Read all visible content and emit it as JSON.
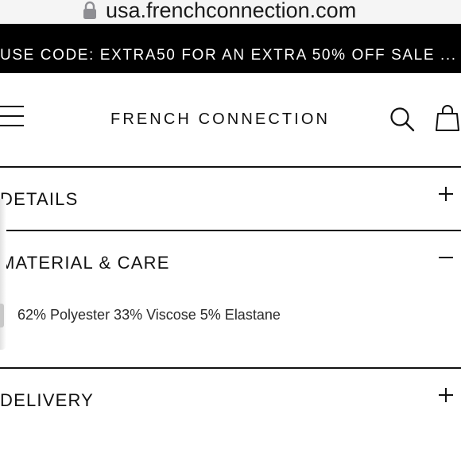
{
  "browser": {
    "url": "usa.frenchconnection.com",
    "lock_icon": "lock-icon"
  },
  "promo": {
    "text": "USE CODE: EXTRA50 FOR AN EXTRA 50% OFF SALE ..."
  },
  "header": {
    "brand": "FRENCH CONNECTION",
    "menu_icon": "hamburger-menu-icon",
    "search_icon": "search-icon",
    "bag_icon": "shopping-bag-icon"
  },
  "accordion": {
    "details": {
      "title": "DETAILS",
      "toggle": "+",
      "state": "collapsed"
    },
    "material": {
      "title": "MATERIAL & CARE",
      "toggle": "−",
      "state": "expanded",
      "content": "62% Polyester 33% Viscose 5% Elastane"
    },
    "delivery": {
      "title": "DELIVERY",
      "toggle": "+",
      "state": "collapsed"
    }
  },
  "colors": {
    "promo_bg": "#000000",
    "promo_text": "#ffffff",
    "text": "#111111",
    "background": "#ffffff"
  }
}
